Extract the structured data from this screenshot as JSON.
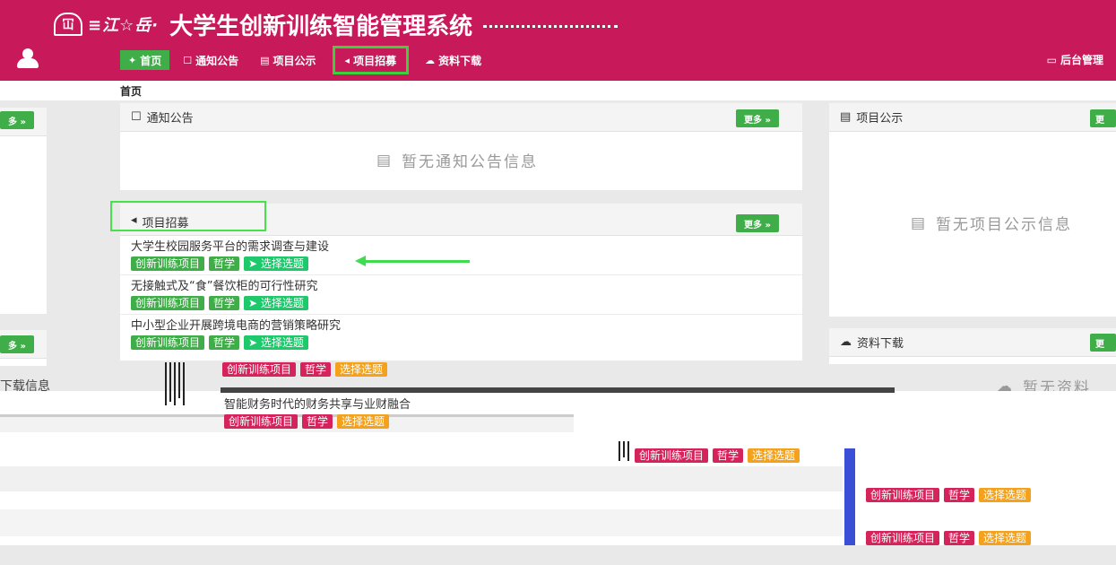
{
  "header": {
    "logo_glyph": "冚",
    "school_name": "≡江☆岳·",
    "system_title": "大学生创新训练智能管理系统",
    "admin_label": "后台管理",
    "admin_icon": "monitor-icon"
  },
  "nav": {
    "items": [
      {
        "icon": "home-icon",
        "glyph": "✦",
        "label": "首页"
      },
      {
        "icon": "notice-icon",
        "glyph": "☐",
        "label": "通知公告"
      },
      {
        "icon": "publicity-icon",
        "glyph": "▤",
        "label": "项目公示"
      },
      {
        "icon": "megaphone-icon",
        "glyph": "◂",
        "label": "项目招募"
      },
      {
        "icon": "cloud-icon",
        "glyph": "☁",
        "label": "资料下载"
      }
    ]
  },
  "breadcrumb": "首页",
  "left_panel": {
    "more": "多 »"
  },
  "left_panel2": {
    "more": "多 »",
    "text": "下载信息"
  },
  "notice_panel": {
    "title": "通知公告",
    "more": "更多 »",
    "empty": "暂无通知公告信息"
  },
  "recruit_panel": {
    "title": "项目招募",
    "more": "更多 »",
    "items": [
      {
        "title": "大学生校园服务平台的需求调查与建设",
        "type": "创新训练项目",
        "subject": "哲学",
        "pick": "选择选题"
      },
      {
        "title": "无接触式及“食”餐饮柜的可行性研究",
        "type": "创新训练项目",
        "subject": "哲学",
        "pick": "选择选题"
      },
      {
        "title": "中小型企业开展跨境电商的营销策略研究",
        "type": "创新训练项目",
        "subject": "哲学",
        "pick": "选择选题"
      }
    ]
  },
  "publicity_panel": {
    "title": "项目公示",
    "more": "更",
    "empty": "暂无项目公示信息"
  },
  "download_panel": {
    "title": "资料下载",
    "more": "更",
    "empty": "暂无资料"
  },
  "ghost": {
    "item4_title": "智能财务时代的财务共享与业财融合",
    "tag_type": "创新训练项目",
    "tag_subject": "哲学",
    "tag_pick": "选择选题"
  },
  "colors": {
    "header": "#c81a5a",
    "nav_active": "#3fae49",
    "highlight_box": "#46e24c",
    "tag_green": "#3fae49",
    "tag_pink": "#d5245c",
    "tag_orange": "#f4a21c"
  }
}
